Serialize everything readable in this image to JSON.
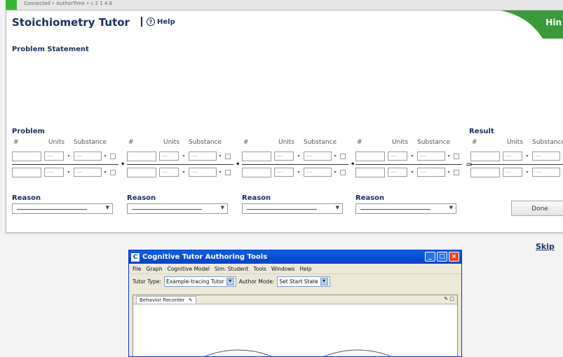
{
  "statusbar": {
    "text": "Connected • AuthorTime • c 2 1 4 8"
  },
  "tutor": {
    "title": "Stoichiometry Tutor",
    "help_label": "Help",
    "hint_label": "Hin",
    "problem_statement_label": "Problem Statement",
    "problem_label": "Problem",
    "result_label": "Result",
    "column_headers": {
      "number": "#",
      "units": "Units",
      "substance": "Substance"
    },
    "dash_placeholder": "----",
    "reason_label": "Reason",
    "done_label": "Done"
  },
  "skip_label": "Skip",
  "ctat": {
    "title": "Cognitive Tutor Authoring Tools",
    "icon_letter": "C",
    "menu": [
      "File",
      "Graph",
      "Cognitive Model",
      "Sim. Student",
      "Tools",
      "Windows",
      "Help"
    ],
    "tutor_type_label": "Tutor Type:",
    "tutor_type_value": "Example-tracing Tutor",
    "author_mode_label": "Author Mode:",
    "author_mode_value": "Set Start State",
    "panel_tab": "Behavior Recorder"
  },
  "colors": {
    "title": "#1a2f5f",
    "hint_green": "#3a9a3a",
    "status_green": "#34b834",
    "xp_blue": "#0a5fe6"
  }
}
